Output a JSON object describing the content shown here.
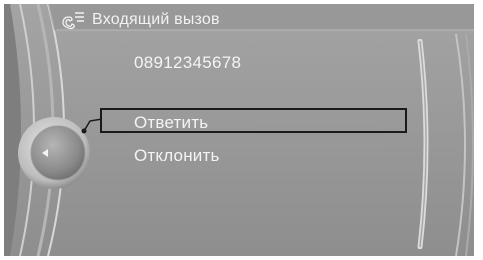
{
  "header": {
    "icon": "incoming-call-icon",
    "title": "Входящий вызов"
  },
  "call": {
    "number": "08912345678"
  },
  "menu": {
    "items": [
      {
        "label": "Ответить",
        "selected": true
      },
      {
        "label": "Отклонить",
        "selected": false
      }
    ]
  },
  "controller": {
    "icon": "controller-knob-icon",
    "arrow_icon": "left-arrow-icon"
  },
  "colors": {
    "background": "#9a9a9a",
    "text": "#f4f4f4",
    "highlight_border": "#1a1a1a"
  }
}
